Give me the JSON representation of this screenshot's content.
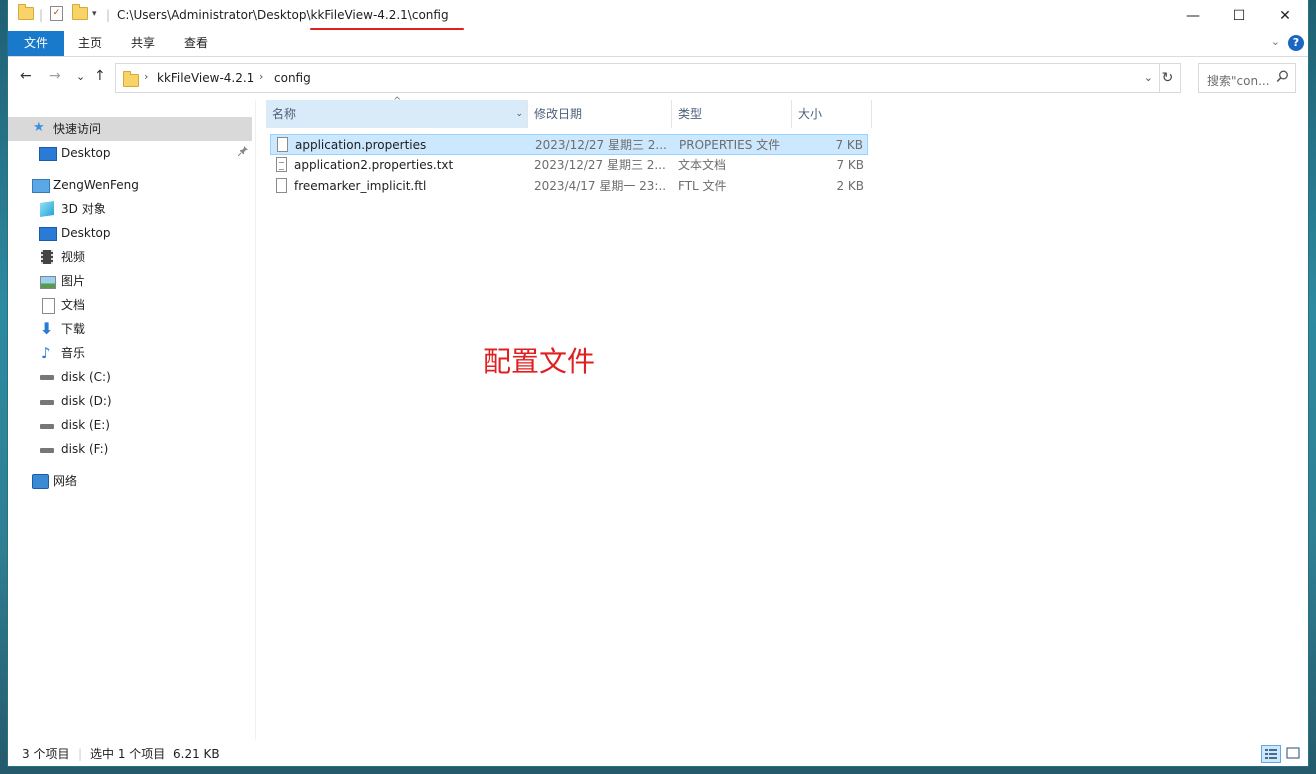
{
  "window": {
    "title": "C:\\Users\\Administrator\\Desktop\\kkFileView-4.2.1\\config",
    "controls": {
      "minimize": "—",
      "maximize": "☐",
      "close": "✕"
    }
  },
  "ribbon": {
    "tabs": [
      "文件",
      "主页",
      "共享",
      "查看"
    ],
    "help": "?",
    "expand": "⌄"
  },
  "nav": {
    "back": "←",
    "forward": "→",
    "recent": "⌄",
    "up": "↑"
  },
  "address": {
    "crumbs": [
      "kkFileView-4.2.1",
      "config"
    ],
    "sep": "›",
    "dropdown": "⌄",
    "refresh": "↻"
  },
  "search": {
    "placeholder": "搜索\"con...",
    "icon": "search-icon"
  },
  "sidebar": {
    "items": [
      {
        "label": "快速访问",
        "icon": "star-icon"
      },
      {
        "label": "Desktop",
        "icon": "desktop-icon",
        "pinned": "📌"
      },
      {
        "label": "ZengWenFeng",
        "icon": "computer-icon"
      },
      {
        "label": "3D 对象",
        "icon": "cube-icon"
      },
      {
        "label": "Desktop",
        "icon": "desktop-icon"
      },
      {
        "label": "视频",
        "icon": "video-icon"
      },
      {
        "label": "图片",
        "icon": "picture-icon"
      },
      {
        "label": "文档",
        "icon": "document-icon"
      },
      {
        "label": "下载",
        "icon": "download-icon"
      },
      {
        "label": "音乐",
        "icon": "music-icon"
      },
      {
        "label": "disk (C:)",
        "icon": "drive-icon"
      },
      {
        "label": "disk (D:)",
        "icon": "drive-icon"
      },
      {
        "label": "disk (E:)",
        "icon": "drive-icon"
      },
      {
        "label": "disk (F:)",
        "icon": "drive-icon"
      },
      {
        "label": "网络",
        "icon": "network-icon"
      }
    ]
  },
  "columns": {
    "name": "名称",
    "date": "修改日期",
    "type": "类型",
    "size": "大小",
    "sort_indicator": "^",
    "dropdown": "⌄"
  },
  "files": [
    {
      "name": "application.properties",
      "date": "2023/12/27 星期三 2...",
      "type": "PROPERTIES 文件",
      "size": "7 KB"
    },
    {
      "name": "application2.properties.txt",
      "date": "2023/12/27 星期三 2...",
      "type": "文本文档",
      "size": "7 KB"
    },
    {
      "name": "freemarker_implicit.ftl",
      "date": "2023/4/17 星期一 23:...",
      "type": "FTL 文件",
      "size": "2 KB"
    }
  ],
  "annotation": "配置文件",
  "status": {
    "count": "3 个项目",
    "selected": "选中 1 个项目",
    "selected_size": "6.21 KB"
  },
  "colors": {
    "accent": "#1979ca",
    "selection": "#cce8ff",
    "annotation": "#e02020"
  }
}
